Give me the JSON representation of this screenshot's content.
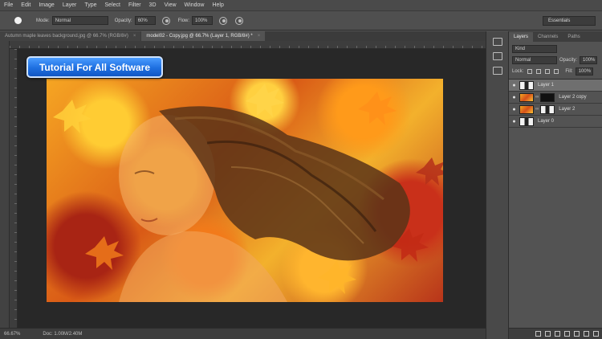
{
  "menu": [
    "File",
    "Edit",
    "Image",
    "Layer",
    "Type",
    "Select",
    "Filter",
    "3D",
    "View",
    "Window",
    "Help"
  ],
  "options": {
    "mode_label": "Mode:",
    "mode_value": "Normal",
    "opacity_label": "Opacity:",
    "opacity_value": "60%",
    "flow_label": "Flow:",
    "flow_value": "100%",
    "workspace": "Essentials"
  },
  "tabs": [
    {
      "label": "Autumn maple leaves background.jpg @ 66.7% (RGB/8#)",
      "active": false
    },
    {
      "label": "model02 - Copy.jpg @ 66.7% (Layer 1, RGB/8#) *",
      "active": true
    }
  ],
  "overlay": {
    "text": "Tutorial For All Software"
  },
  "status": {
    "zoom": "66.67%",
    "doc": "Doc: 1.00M/2.40M"
  },
  "panel": {
    "tabs": [
      "Layers",
      "Channels",
      "Paths"
    ],
    "filter_kind": "Kind",
    "blend_mode": "Normal",
    "opacity_label": "Opacity:",
    "opacity_value": "100%",
    "lock_label": "Lock:",
    "fill_label": "Fill:",
    "fill_value": "100%",
    "layers": [
      {
        "name": "Layer 1",
        "selected": true
      },
      {
        "name": "Layer 2 copy",
        "selected": false
      },
      {
        "name": "Layer 2",
        "selected": false
      },
      {
        "name": "Layer 0",
        "selected": false
      }
    ]
  },
  "icons": {
    "eye": "eye-icon",
    "link": "link-icon"
  }
}
